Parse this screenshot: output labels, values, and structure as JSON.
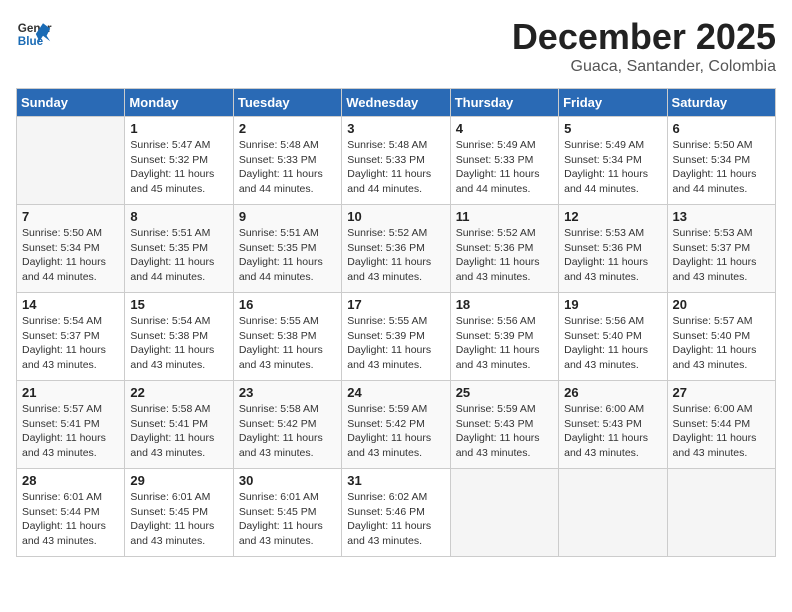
{
  "header": {
    "logo_line1": "General",
    "logo_line2": "Blue",
    "month": "December 2025",
    "location": "Guaca, Santander, Colombia"
  },
  "weekdays": [
    "Sunday",
    "Monday",
    "Tuesday",
    "Wednesday",
    "Thursday",
    "Friday",
    "Saturday"
  ],
  "weeks": [
    [
      {
        "day": "",
        "detail": ""
      },
      {
        "day": "1",
        "detail": "Sunrise: 5:47 AM\nSunset: 5:32 PM\nDaylight: 11 hours\nand 45 minutes."
      },
      {
        "day": "2",
        "detail": "Sunrise: 5:48 AM\nSunset: 5:33 PM\nDaylight: 11 hours\nand 44 minutes."
      },
      {
        "day": "3",
        "detail": "Sunrise: 5:48 AM\nSunset: 5:33 PM\nDaylight: 11 hours\nand 44 minutes."
      },
      {
        "day": "4",
        "detail": "Sunrise: 5:49 AM\nSunset: 5:33 PM\nDaylight: 11 hours\nand 44 minutes."
      },
      {
        "day": "5",
        "detail": "Sunrise: 5:49 AM\nSunset: 5:34 PM\nDaylight: 11 hours\nand 44 minutes."
      },
      {
        "day": "6",
        "detail": "Sunrise: 5:50 AM\nSunset: 5:34 PM\nDaylight: 11 hours\nand 44 minutes."
      }
    ],
    [
      {
        "day": "7",
        "detail": "Sunrise: 5:50 AM\nSunset: 5:34 PM\nDaylight: 11 hours\nand 44 minutes."
      },
      {
        "day": "8",
        "detail": "Sunrise: 5:51 AM\nSunset: 5:35 PM\nDaylight: 11 hours\nand 44 minutes."
      },
      {
        "day": "9",
        "detail": "Sunrise: 5:51 AM\nSunset: 5:35 PM\nDaylight: 11 hours\nand 44 minutes."
      },
      {
        "day": "10",
        "detail": "Sunrise: 5:52 AM\nSunset: 5:36 PM\nDaylight: 11 hours\nand 43 minutes."
      },
      {
        "day": "11",
        "detail": "Sunrise: 5:52 AM\nSunset: 5:36 PM\nDaylight: 11 hours\nand 43 minutes."
      },
      {
        "day": "12",
        "detail": "Sunrise: 5:53 AM\nSunset: 5:36 PM\nDaylight: 11 hours\nand 43 minutes."
      },
      {
        "day": "13",
        "detail": "Sunrise: 5:53 AM\nSunset: 5:37 PM\nDaylight: 11 hours\nand 43 minutes."
      }
    ],
    [
      {
        "day": "14",
        "detail": "Sunrise: 5:54 AM\nSunset: 5:37 PM\nDaylight: 11 hours\nand 43 minutes."
      },
      {
        "day": "15",
        "detail": "Sunrise: 5:54 AM\nSunset: 5:38 PM\nDaylight: 11 hours\nand 43 minutes."
      },
      {
        "day": "16",
        "detail": "Sunrise: 5:55 AM\nSunset: 5:38 PM\nDaylight: 11 hours\nand 43 minutes."
      },
      {
        "day": "17",
        "detail": "Sunrise: 5:55 AM\nSunset: 5:39 PM\nDaylight: 11 hours\nand 43 minutes."
      },
      {
        "day": "18",
        "detail": "Sunrise: 5:56 AM\nSunset: 5:39 PM\nDaylight: 11 hours\nand 43 minutes."
      },
      {
        "day": "19",
        "detail": "Sunrise: 5:56 AM\nSunset: 5:40 PM\nDaylight: 11 hours\nand 43 minutes."
      },
      {
        "day": "20",
        "detail": "Sunrise: 5:57 AM\nSunset: 5:40 PM\nDaylight: 11 hours\nand 43 minutes."
      }
    ],
    [
      {
        "day": "21",
        "detail": "Sunrise: 5:57 AM\nSunset: 5:41 PM\nDaylight: 11 hours\nand 43 minutes."
      },
      {
        "day": "22",
        "detail": "Sunrise: 5:58 AM\nSunset: 5:41 PM\nDaylight: 11 hours\nand 43 minutes."
      },
      {
        "day": "23",
        "detail": "Sunrise: 5:58 AM\nSunset: 5:42 PM\nDaylight: 11 hours\nand 43 minutes."
      },
      {
        "day": "24",
        "detail": "Sunrise: 5:59 AM\nSunset: 5:42 PM\nDaylight: 11 hours\nand 43 minutes."
      },
      {
        "day": "25",
        "detail": "Sunrise: 5:59 AM\nSunset: 5:43 PM\nDaylight: 11 hours\nand 43 minutes."
      },
      {
        "day": "26",
        "detail": "Sunrise: 6:00 AM\nSunset: 5:43 PM\nDaylight: 11 hours\nand 43 minutes."
      },
      {
        "day": "27",
        "detail": "Sunrise: 6:00 AM\nSunset: 5:44 PM\nDaylight: 11 hours\nand 43 minutes."
      }
    ],
    [
      {
        "day": "28",
        "detail": "Sunrise: 6:01 AM\nSunset: 5:44 PM\nDaylight: 11 hours\nand 43 minutes."
      },
      {
        "day": "29",
        "detail": "Sunrise: 6:01 AM\nSunset: 5:45 PM\nDaylight: 11 hours\nand 43 minutes."
      },
      {
        "day": "30",
        "detail": "Sunrise: 6:01 AM\nSunset: 5:45 PM\nDaylight: 11 hours\nand 43 minutes."
      },
      {
        "day": "31",
        "detail": "Sunrise: 6:02 AM\nSunset: 5:46 PM\nDaylight: 11 hours\nand 43 minutes."
      },
      {
        "day": "",
        "detail": ""
      },
      {
        "day": "",
        "detail": ""
      },
      {
        "day": "",
        "detail": ""
      }
    ]
  ]
}
